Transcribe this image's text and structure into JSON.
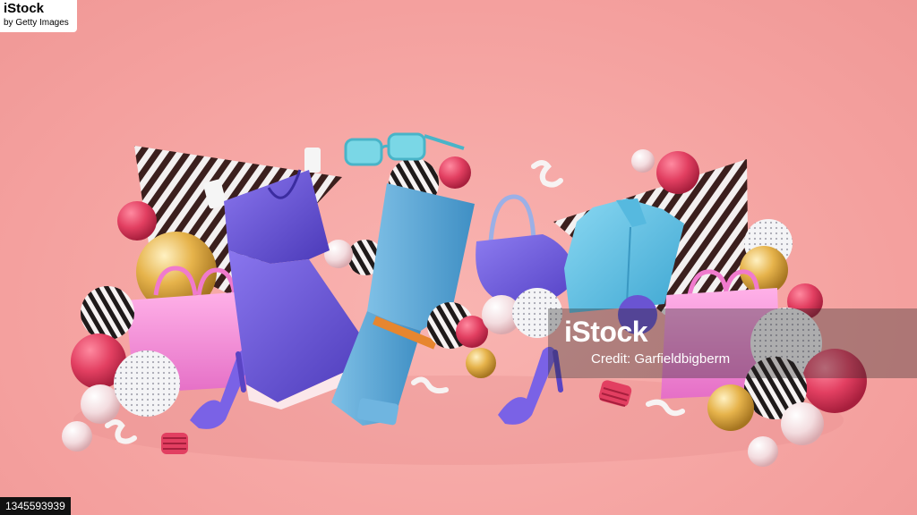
{
  "watermark": {
    "brand": "iStock",
    "credit": "Credit: Garfieldbigberm"
  },
  "corner_logo": {
    "line1": "iStock",
    "line2": "by Getty Images"
  },
  "asset_id": "1345593939",
  "colors": {
    "background": "#f6a7a5",
    "dress": "#6b57d6",
    "jeans": "#5aa7d6",
    "shirt": "#66c3e6",
    "bag": "#f58ad7",
    "gold_ball": "#e6b34b",
    "red_ball": "#e23f61"
  }
}
